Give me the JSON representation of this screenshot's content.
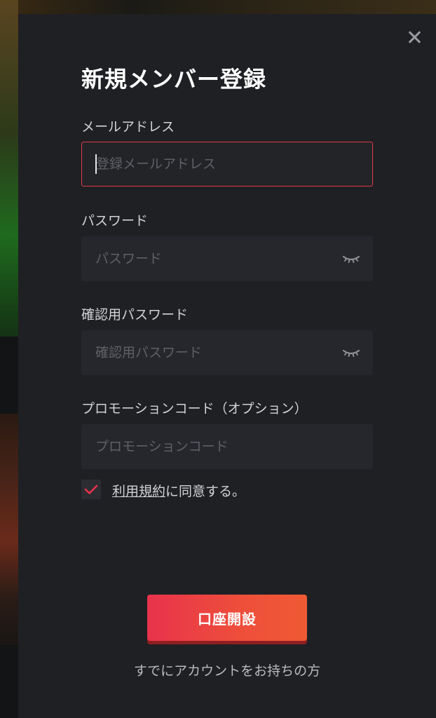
{
  "dialog": {
    "title": "新規メンバー登録"
  },
  "email": {
    "label": "メールアドレス",
    "placeholder": "登録メールアドレス",
    "value": ""
  },
  "password": {
    "label": "パスワード",
    "placeholder": "パスワード",
    "value": ""
  },
  "confirm_password": {
    "label": "確認用パスワード",
    "placeholder": "確認用パスワード",
    "value": ""
  },
  "promo": {
    "label": "プロモーションコード（オプション）",
    "placeholder": "プロモーションコード",
    "value": ""
  },
  "terms": {
    "checked": true,
    "link_text": "利用規約",
    "suffix_text": "に同意する。"
  },
  "actions": {
    "submit_label": "口座開設",
    "login_link": "すでにアカウントをお持ちの方"
  },
  "colors": {
    "accent": "#e8334c",
    "error_border": "#e23a48",
    "modal_bg": "#1f2024",
    "field_bg": "#26272c"
  },
  "icons": {
    "close": "close-icon",
    "password_toggle": "eye-closed-icon",
    "check": "checkmark-icon"
  }
}
